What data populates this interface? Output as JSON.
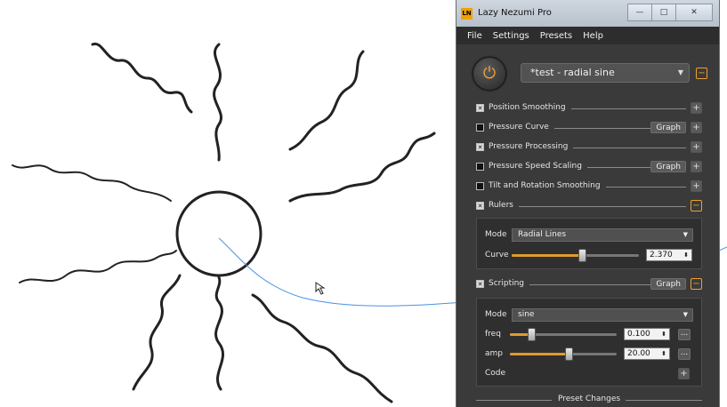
{
  "window": {
    "app_icon_text": "LN",
    "title": "Lazy Nezumi Pro",
    "minimize": "—",
    "maximize": "□",
    "close": "✕"
  },
  "menu": [
    "File",
    "Settings",
    "Presets",
    "Help"
  ],
  "preset": {
    "name": "*test - radial sine",
    "minus_label": "−",
    "power_icon": "⏻"
  },
  "rows": [
    {
      "label": "Position Smoothing",
      "checked": true,
      "graph": "",
      "btn": "+"
    },
    {
      "label": "Pressure Curve",
      "checked": false,
      "graph": "Graph",
      "btn": "+"
    },
    {
      "label": "Pressure Processing",
      "checked": true,
      "graph": "",
      "btn": "+"
    },
    {
      "label": "Pressure Speed Scaling",
      "checked": false,
      "graph": "Graph",
      "btn": "+"
    },
    {
      "label": "Tilt and Rotation Smoothing",
      "checked": false,
      "graph": "",
      "btn": "+"
    },
    {
      "label": "Rulers",
      "checked": true,
      "graph": "",
      "btn": "−"
    }
  ],
  "rulers_panel": {
    "mode_label": "Mode",
    "mode_value": "Radial Lines",
    "curve_label": "Curve",
    "curve_value": "2.370",
    "curve_level": 0.55
  },
  "scripting": {
    "label": "Scripting",
    "checked": true,
    "graph": "Graph",
    "btn": "−"
  },
  "scripting_panel": {
    "mode_label": "Mode",
    "mode_value": "sine",
    "freq_label": "freq",
    "freq_value": "0.100",
    "freq_level": 0.2,
    "amp_label": "amp",
    "amp_value": "20.00",
    "amp_level": 0.55,
    "dots": "...",
    "code_label": "Code",
    "code_btn": "+"
  },
  "footer": {
    "label": "Preset Changes"
  },
  "colors": {
    "accent": "#e09a2c",
    "panel_bg": "#3a3a3a",
    "guide_line": "#4a90e2",
    "stroke": "#222222"
  },
  "icons": {
    "power": "power-icon",
    "dropdown": "chevron-down-icon",
    "cursor": "mouse-cursor-icon"
  }
}
